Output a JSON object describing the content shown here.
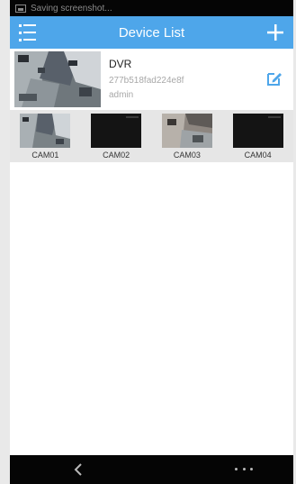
{
  "status_bar": {
    "text": "Saving screenshot..."
  },
  "app_bar": {
    "title": "Device List"
  },
  "device": {
    "name": "DVR",
    "id": "277b518fad224e8f",
    "user": "admin"
  },
  "cameras": [
    {
      "label": "CAM01"
    },
    {
      "label": "CAM02"
    },
    {
      "label": "CAM03"
    },
    {
      "label": "CAM04"
    }
  ],
  "colors": {
    "accent": "#4ea6ea",
    "status_bar": "#050505",
    "camera_strip": "#e6e6e6"
  },
  "icons": {
    "menu": "menu-icon",
    "add": "plus-icon",
    "edit": "edit-icon",
    "back": "chevron-left-icon",
    "more": "more-dots-icon",
    "screenshot": "screenshot-icon"
  }
}
